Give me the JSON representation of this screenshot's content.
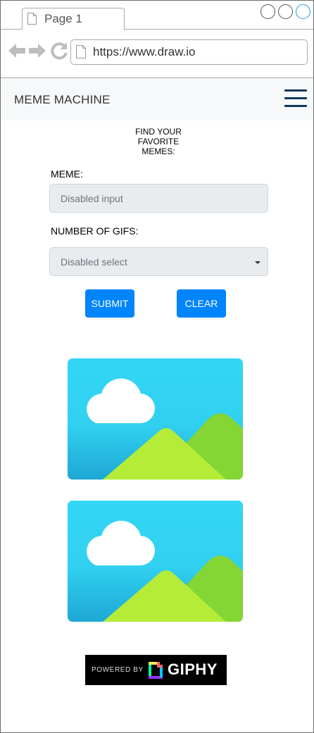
{
  "browser": {
    "tab_title": "Page 1",
    "url": "https://www.draw.io"
  },
  "header": {
    "brand": "MEME MACHINE",
    "menu_icon": "hamburger-menu-icon"
  },
  "hero": {
    "line1": "FIND YOUR",
    "line2": "FAVORITE",
    "line3": "MEMES:"
  },
  "form": {
    "meme_label": "MEME:",
    "meme_placeholder": "Disabled input",
    "gifs_label": "NUMBER OF GIFS:",
    "gifs_selected": "Disabled select",
    "submit_label": "SUBMIT",
    "clear_label": "CLEAR"
  },
  "results": {
    "images": [
      "image-placeholder-icon",
      "image-placeholder-icon"
    ]
  },
  "footer": {
    "powered_by": "POWERED BY",
    "brand": "GIPHY"
  },
  "colors": {
    "primary_button": "#0085fc",
    "header_bg": "#f6f8fa",
    "menu_icon": "#10375c",
    "sky_top": "#33d6f4",
    "sky_bottom": "#1ea7d4",
    "hill_light": "#b5ec38",
    "hill_dark": "#83d634"
  }
}
